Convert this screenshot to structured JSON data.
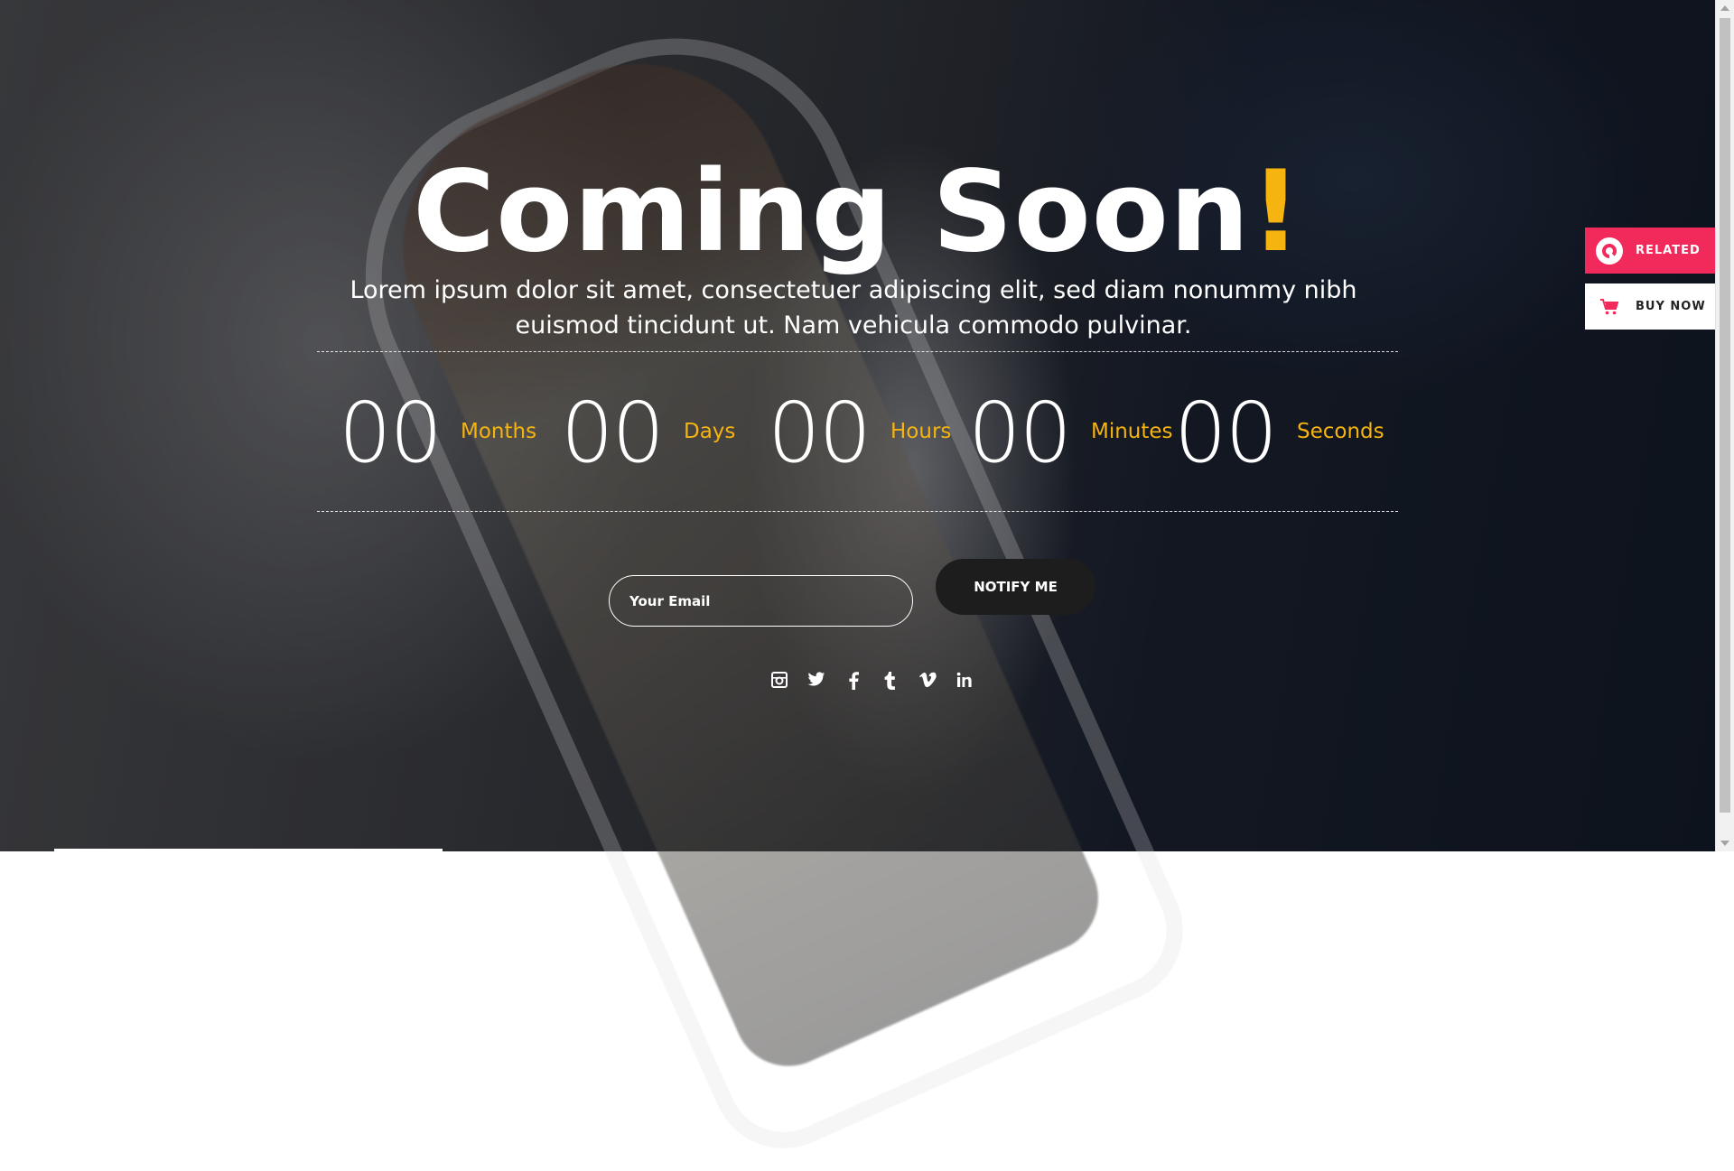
{
  "hero": {
    "title": "Coming Soon",
    "title_accent": "!",
    "subtitle": "Lorem ipsum dolor sit amet, consectetuer adipiscing elit, sed diam nonummy nibh euismod tincidunt ut. Nam vehicula commodo pulvinar."
  },
  "countdown": [
    {
      "value": "00",
      "label": "Months"
    },
    {
      "value": "00",
      "label": "Days"
    },
    {
      "value": "00",
      "label": "Hours"
    },
    {
      "value": "00",
      "label": "Minutes"
    },
    {
      "value": "00",
      "label": "Seconds"
    }
  ],
  "subscribe": {
    "email_placeholder": "Your Email",
    "button_label": "NOTIFY ME"
  },
  "social": [
    "instagram-icon",
    "twitter-icon",
    "facebook-icon",
    "tumblr-icon",
    "vimeo-icon",
    "linkedin-icon"
  ],
  "side_panel": {
    "related_label": "RELATED",
    "buy_label": "BUY NOW"
  },
  "colors": {
    "accent": "#f5b40f",
    "related_bg": "#f2295b",
    "notify_bg": "#1d1d1d"
  }
}
